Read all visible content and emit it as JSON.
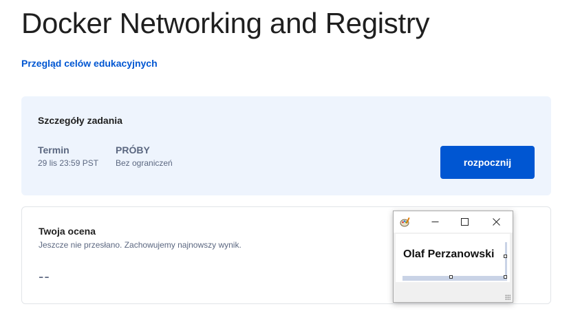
{
  "page": {
    "title": "Docker Networking and Registry",
    "overview_link": "Przegląd celów edukacyjnych"
  },
  "assignment_details": {
    "heading": "Szczegóły zadania",
    "due": {
      "label": "Termin",
      "value": "29 lis 23:59 PST"
    },
    "attempts": {
      "label": "PRÓBY",
      "value": "Bez ograniczeń"
    },
    "start_button": "rozpocznij"
  },
  "grade": {
    "heading": "Twoja ocena",
    "status": "Jeszcze nie przesłano. Zachowujemy najnowszy wynik.",
    "value": "--"
  },
  "mini_window": {
    "label_text": "Olaf Perzanowski",
    "icon": "paint-palette-icon",
    "buttons": {
      "minimize": "—",
      "maximize": "☐",
      "close": "✕"
    }
  },
  "colors": {
    "accent": "#0056d2",
    "details_bg": "#eef4fd",
    "muted_text": "#5b6780"
  }
}
